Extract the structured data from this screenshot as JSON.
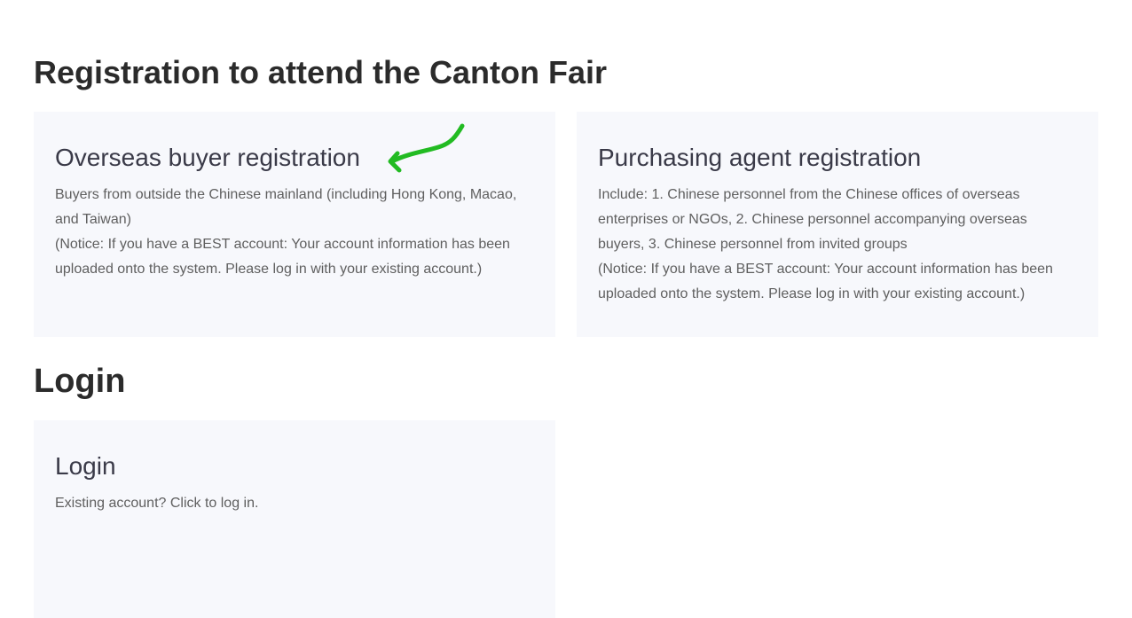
{
  "registration": {
    "title": "Registration to attend the Canton Fair",
    "cards": [
      {
        "title": "Overseas buyer registration",
        "description": "Buyers from outside the Chinese mainland (including Hong Kong, Macao, and Taiwan)",
        "notice": "(Notice: If you have a BEST account: Your account information has been uploaded onto the system. Please log in with your existing account.)"
      },
      {
        "title": "Purchasing agent registration",
        "description": "Include: 1. Chinese personnel from the Chinese offices of overseas enterprises or NGOs, 2. Chinese personnel accompanying overseas buyers, 3. Chinese personnel from invited groups",
        "notice": "(Notice: If you have a BEST account: Your account information has been uploaded onto the system. Please log in with your existing account.)"
      }
    ]
  },
  "login": {
    "title": "Login",
    "card": {
      "title": "Login",
      "description": "Existing account? Click to log in."
    }
  },
  "annotation": {
    "arrow_color": "#22bb22"
  },
  "colors": {
    "card_background": "#f7f8fc",
    "heading": "#2b2b2b",
    "card_title": "#3a3a48",
    "body_text": "#5f5f5f"
  }
}
